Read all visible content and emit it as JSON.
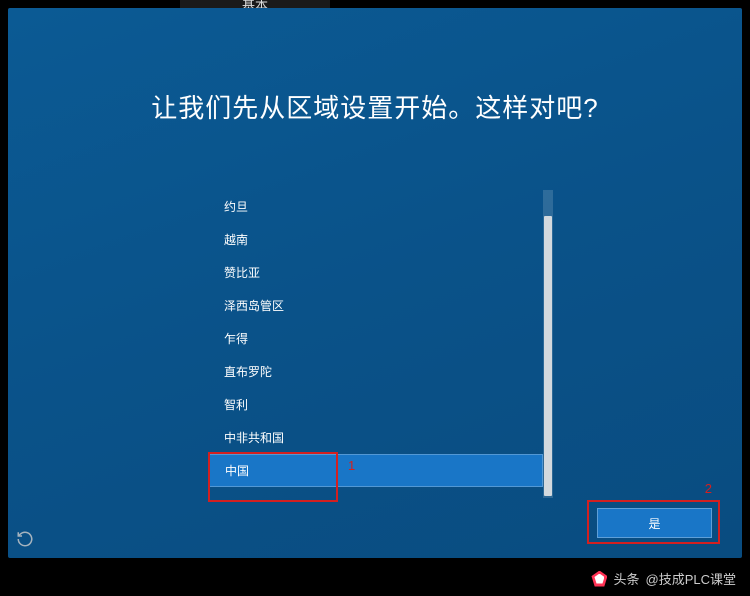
{
  "tab": {
    "label": "基本"
  },
  "heading": "让我们先从区域设置开始。这样对吧?",
  "regions": [
    {
      "label": "约旦",
      "selected": false
    },
    {
      "label": "越南",
      "selected": false
    },
    {
      "label": "赞比亚",
      "selected": false
    },
    {
      "label": "泽西岛管区",
      "selected": false
    },
    {
      "label": "乍得",
      "selected": false
    },
    {
      "label": "直布罗陀",
      "selected": false
    },
    {
      "label": "智利",
      "selected": false
    },
    {
      "label": "中非共和国",
      "selected": false
    },
    {
      "label": "中国",
      "selected": true
    }
  ],
  "confirm_button": {
    "label": "是"
  },
  "annotations": {
    "marker1": "1",
    "marker2": "2"
  },
  "watermark": {
    "text": "@技成PLC课堂",
    "prefix": "头条"
  }
}
